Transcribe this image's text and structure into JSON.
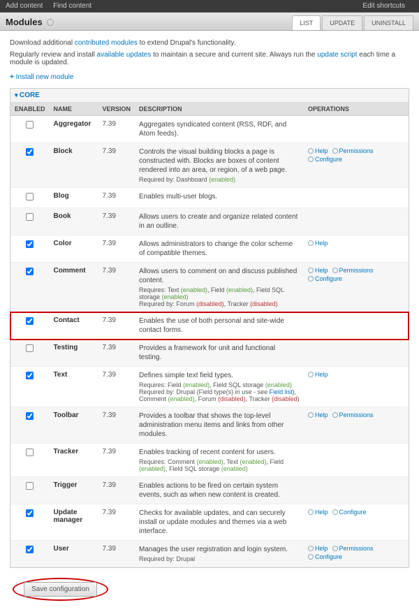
{
  "topbar": {
    "add": "Add content",
    "find": "Find content",
    "edit": "Edit shortcuts"
  },
  "title": "Modules",
  "tabs": {
    "list": "LIST",
    "update": "UPDATE",
    "uninstall": "UNINSTALL"
  },
  "intro1a": "Download additional ",
  "intro1b": "contributed modules",
  "intro1c": " to extend Drupal's functionality.",
  "intro2a": "Regularly review and install ",
  "intro2b": "available updates",
  "intro2c": " to maintain a secure and current site. Always run the ",
  "intro2d": "update script",
  "intro2e": " each time a module is updated.",
  "install": "Install new module",
  "legend": "CORE",
  "cols": {
    "enabled": "ENABLED",
    "name": "NAME",
    "version": "VERSION",
    "description": "DESCRIPTION",
    "operations": "OPERATIONS"
  },
  "ops": {
    "help": "Help",
    "permissions": "Permissions",
    "configure": "Configure"
  },
  "ver": "7.39",
  "rows": [
    {
      "name": "Aggregator",
      "enabled": false,
      "desc": "Aggregates syndicated content (RSS, RDF, and Atom feeds).",
      "help": false,
      "perm": false,
      "conf": false
    },
    {
      "name": "Block",
      "enabled": true,
      "desc": "Controls the visual building blocks a page is constructed with. Blocks are boxes of content rendered into an area, or region, of a web page.",
      "req": "Required by: Dashboard <en>(enabled)</en>",
      "help": true,
      "perm": true,
      "conf": true
    },
    {
      "name": "Blog",
      "enabled": false,
      "desc": "Enables multi-user blogs.",
      "help": false,
      "perm": false,
      "conf": false
    },
    {
      "name": "Book",
      "enabled": false,
      "desc": "Allows users to create and organize related content in an outline.",
      "help": false,
      "perm": false,
      "conf": false
    },
    {
      "name": "Color",
      "enabled": true,
      "desc": "Allows administrators to change the color scheme of compatible themes.",
      "help": true,
      "perm": false,
      "conf": false
    },
    {
      "name": "Comment",
      "enabled": true,
      "desc": "Allows users to comment on and discuss published content.",
      "req": "Requires: Text <en>(enabled)</en>, Field <en>(enabled)</en>, Field SQL storage <en>(enabled)</en><br>Required by: Forum <dis>(disabled)</dis>, Tracker <dis>(disabled)</dis>",
      "help": true,
      "perm": true,
      "conf": true
    },
    {
      "name": "Contact",
      "enabled": true,
      "desc": "Enables the use of both personal and site-wide contact forms.",
      "highlight": true,
      "help": false,
      "perm": false,
      "conf": false
    },
    {
      "name": "Testing",
      "enabled": false,
      "desc": "Provides a framework for unit and functional testing.",
      "help": false,
      "perm": false,
      "conf": false
    },
    {
      "name": "Text",
      "enabled": true,
      "desc": "Defines simple text field types.",
      "req": "Requires: Field <en>(enabled)</en>, Field SQL storage <en>(enabled)</en><br>Required by: Drupal (Field type(s) in use - see <a>Field list</a>), Comment <en>(enabled)</en>, Forum <dis>(disabled)</dis>, Tracker <dis>(disabled)</dis>",
      "help": true,
      "perm": false,
      "conf": false
    },
    {
      "name": "Toolbar",
      "enabled": true,
      "desc": "Provides a toolbar that shows the top-level administration menu items and links from other modules.",
      "help": true,
      "perm": true,
      "conf": false
    },
    {
      "name": "Tracker",
      "enabled": false,
      "desc": "Enables tracking of recent content for users.",
      "req": "Requires: Comment <en>(enabled)</en>, Text <en>(enabled)</en>, Field <en>(enabled)</en>, Field SQL storage <en>(enabled)</en>",
      "help": false,
      "perm": false,
      "conf": false
    },
    {
      "name": "Trigger",
      "enabled": false,
      "desc": "Enables actions to be fired on certain system events, such as when new content is created.",
      "help": false,
      "perm": false,
      "conf": false
    },
    {
      "name": "Update manager",
      "enabled": true,
      "desc": "Checks for available updates, and can securely install or update modules and themes via a web interface.",
      "help": true,
      "perm": false,
      "conf": true
    },
    {
      "name": "User",
      "enabled": true,
      "desc": "Manages the user registration and login system.",
      "req": "Required by: Drupal",
      "help": true,
      "perm": true,
      "conf": true
    }
  ],
  "save": "Save configuration"
}
